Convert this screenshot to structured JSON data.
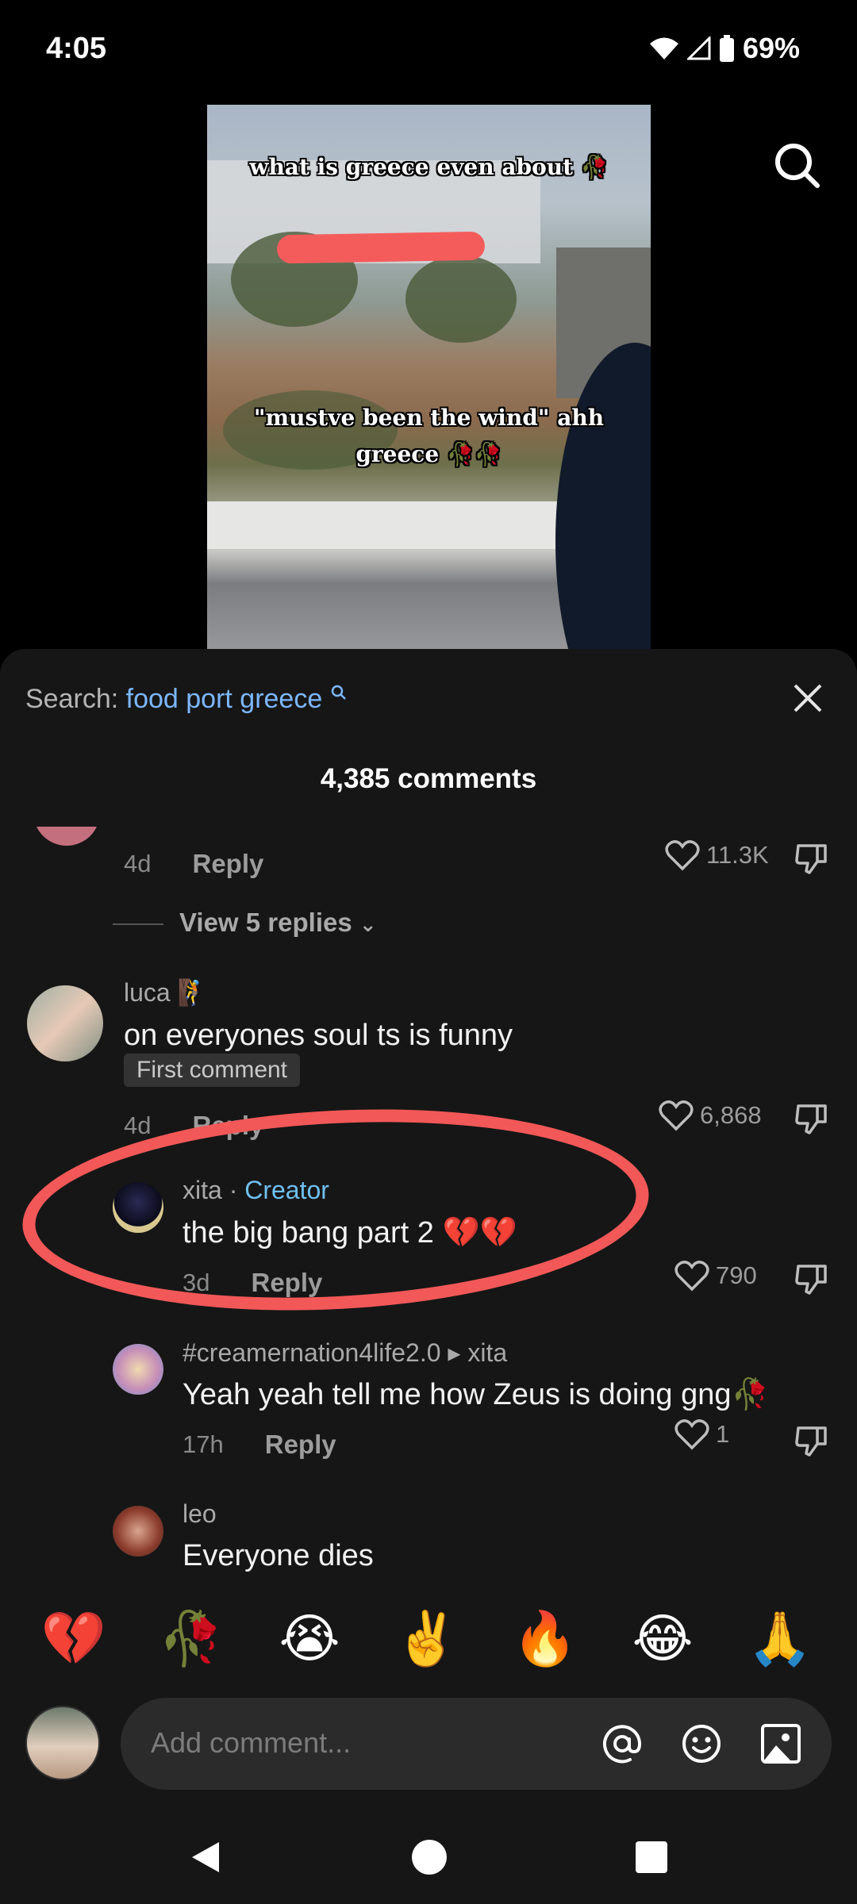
{
  "status": {
    "time": "4:05",
    "battery": "69%"
  },
  "video": {
    "caption_top": "what is greece even about 🥀",
    "caption_bottom_line1": "\"mustve been the wind\" ahh",
    "caption_bottom_line2": "greece 🥀🥀"
  },
  "sheet": {
    "search_prefix": "Search:",
    "search_query": "food port greece",
    "title": "4,385 comments"
  },
  "comments": {
    "c0": {
      "time": "4d",
      "reply": "Reply",
      "likes": "11.3K"
    },
    "view_replies": "View 5 replies",
    "c1": {
      "user": "luca 🧗",
      "text": "on everyones soul ts is funny",
      "badge": "First comment",
      "time": "4d",
      "reply": "Reply",
      "likes": "6,868"
    },
    "c2": {
      "user": "xita",
      "sep": " · ",
      "creator": "Creator",
      "text": "the big bang part 2 💔💔",
      "time": "3d",
      "reply": "Reply",
      "likes": "790"
    },
    "c3": {
      "user": "#creamernation4life2.0",
      "arrow": " ▸ ",
      "to": "xita",
      "text": "Yeah yeah tell me how Zeus is doing gng🥀",
      "time": "17h",
      "reply": "Reply",
      "likes": "1"
    },
    "c4": {
      "user": "leo",
      "text": "Everyone dies"
    }
  },
  "emojis": [
    "💔",
    "🥀",
    "😭",
    "✌️",
    "🔥",
    "😂",
    "🙏"
  ],
  "composer": {
    "placeholder": "Add comment..."
  },
  "colors": {
    "accent_blue": "#7cb7ff",
    "creator_blue": "#6fc0f0",
    "annotation_red": "#f25858"
  }
}
